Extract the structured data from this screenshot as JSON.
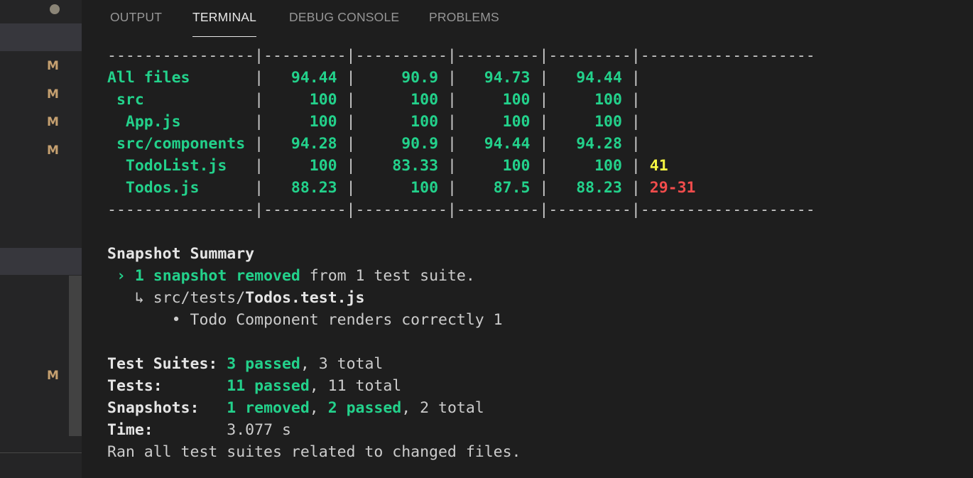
{
  "sidebar": {
    "badges": [
      "M",
      "M",
      "M",
      "M",
      "M"
    ]
  },
  "tabs": [
    {
      "label": "OUTPUT"
    },
    {
      "label": "TERMINAL",
      "active": true
    },
    {
      "label": "DEBUG CONSOLE"
    },
    {
      "label": "PROBLEMS"
    }
  ],
  "terminal": {
    "separator": "----------------|---------|----------|---------|---------|-------------------",
    "coverage_rows": [
      {
        "file": "All files",
        "stmts": "94.44",
        "branch": "90.9",
        "funcs": "94.73",
        "lines": "94.44",
        "uncovered": ""
      },
      {
        "file": "src",
        "stmts": "100",
        "branch": "100",
        "funcs": "100",
        "lines": "100",
        "uncovered": ""
      },
      {
        "file": "App.js",
        "stmts": "100",
        "branch": "100",
        "funcs": "100",
        "lines": "100",
        "uncovered": ""
      },
      {
        "file": "src/components",
        "stmts": "94.28",
        "branch": "90.9",
        "funcs": "94.44",
        "lines": "94.28",
        "uncovered": ""
      },
      {
        "file": "TodoList.js",
        "stmts": "100",
        "branch": "83.33",
        "funcs": "100",
        "lines": "100",
        "uncovered": "41"
      },
      {
        "file": "Todos.js",
        "stmts": "88.23",
        "branch": "100",
        "funcs": "87.5",
        "lines": "88.23",
        "uncovered": "29-31"
      }
    ],
    "snapshot_summary": {
      "heading": "Snapshot Summary",
      "arrow": "›",
      "removed_text": "1 snapshot removed",
      "removed_suffix": " from 1 test suite.",
      "path_arrow": "↳",
      "path_dir": "src/tests/",
      "path_file": "Todos.test.js",
      "bullet": "•",
      "item": "Todo Component renders correctly 1"
    },
    "stats": {
      "suites_label": "Test Suites:",
      "suites_passed": "3 passed",
      "suites_total": ", 3 total",
      "tests_label": "Tests:",
      "tests_passed": "11 passed",
      "tests_total": ", 11 total",
      "snapshots_label": "Snapshots:",
      "snapshots_removed": "1 removed",
      "snapshots_sep": ", ",
      "snapshots_passed": "2 passed",
      "snapshots_total": ", 2 total",
      "time_label": "Time:",
      "time_value": "3.077 s"
    },
    "footer": "Ran all test suites related to changed files."
  },
  "colors": {
    "background": "#1e1e1e",
    "sidebar": "#252526",
    "green": "#23d18b",
    "yellow": "#f5f543",
    "red": "#f14c4c",
    "badge_modified": "#c5a070"
  }
}
